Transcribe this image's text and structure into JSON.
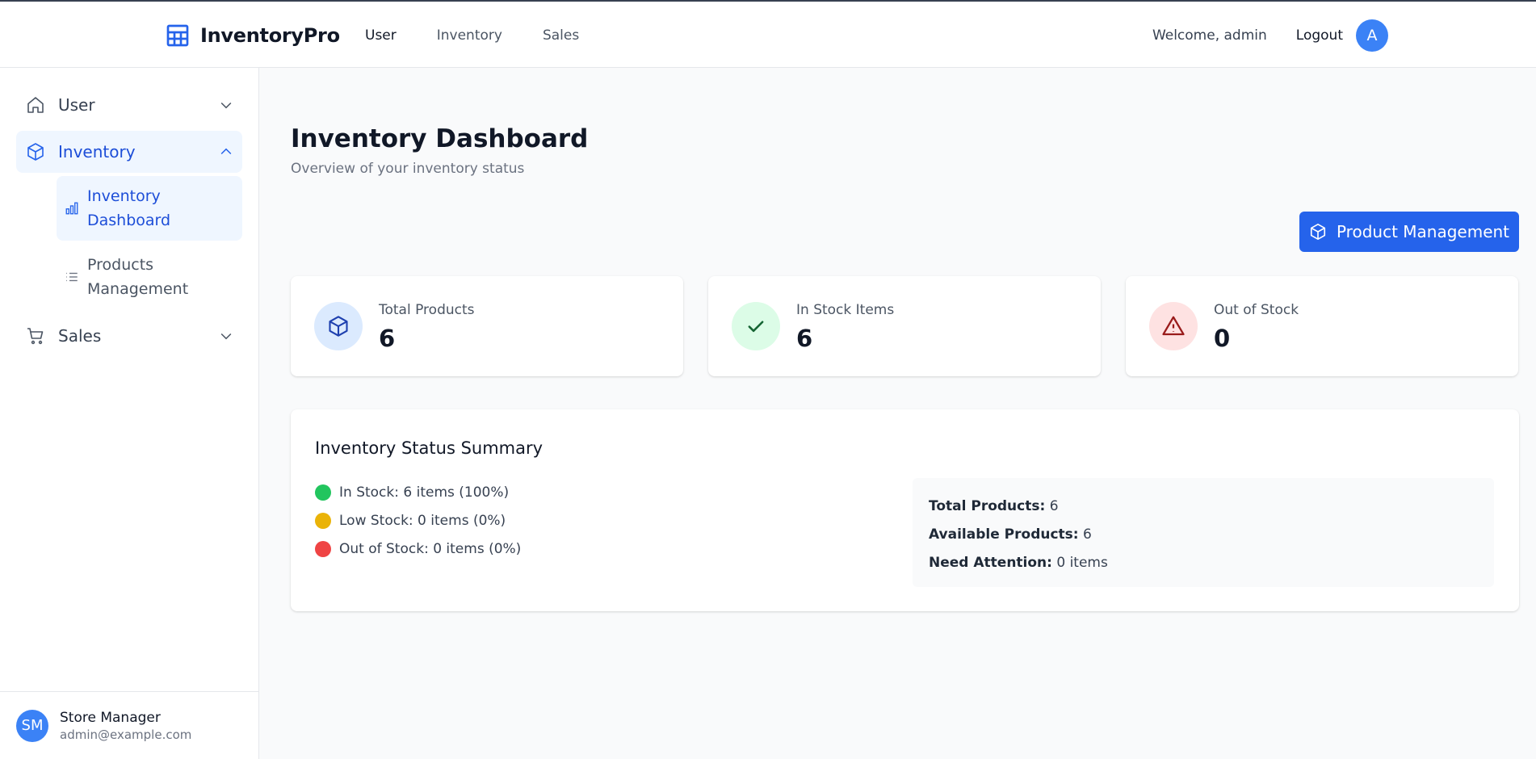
{
  "brand": {
    "name": "InventoryPro",
    "accent": "#2563eb",
    "icon": "table-icon"
  },
  "topnav": {
    "items": [
      "User",
      "Inventory",
      "Sales"
    ],
    "active": "User"
  },
  "topbar": {
    "welcome": "Welcome, admin",
    "logout": "Logout",
    "avatar_initial": "A"
  },
  "sidebar": {
    "items": [
      {
        "label": "User",
        "icon": "home-icon",
        "expanded": false
      },
      {
        "label": "Inventory",
        "icon": "box-icon",
        "expanded": true,
        "children": [
          {
            "label": "Inventory Dashboard",
            "icon": "bar-chart-icon",
            "active": true
          },
          {
            "label": "Products Management",
            "icon": "list-icon",
            "active": false
          }
        ]
      },
      {
        "label": "Sales",
        "icon": "cart-icon",
        "expanded": false
      }
    ],
    "footer": {
      "initials": "SM",
      "name": "Store Manager",
      "email": "admin@example.com"
    }
  },
  "page": {
    "title": "Inventory Dashboard",
    "subtitle": "Overview of your inventory status",
    "action_button": "Product Management"
  },
  "stats": [
    {
      "label": "Total Products",
      "value": "6",
      "icon": "box-icon",
      "color": "#1e40af",
      "bg": "#dbeafe"
    },
    {
      "label": "In Stock Items",
      "value": "6",
      "icon": "check-icon",
      "color": "#166534",
      "bg": "#dcfce7"
    },
    {
      "label": "Out of Stock",
      "value": "0",
      "icon": "warning-icon",
      "color": "#991b1b",
      "bg": "#fee2e2"
    }
  ],
  "summary": {
    "title": "Inventory Status Summary",
    "legend": [
      {
        "text": "In Stock: 6 items (100%)",
        "color": "#22c55e"
      },
      {
        "text": "Low Stock: 0 items (0%)",
        "color": "#eab308"
      },
      {
        "text": "Out of Stock: 0 items (0%)",
        "color": "#ef4444"
      }
    ],
    "totals": [
      {
        "label": "Total Products:",
        "value": "6"
      },
      {
        "label": "Available Products:",
        "value": "6"
      },
      {
        "label": "Need Attention:",
        "value": "0 items"
      }
    ]
  }
}
